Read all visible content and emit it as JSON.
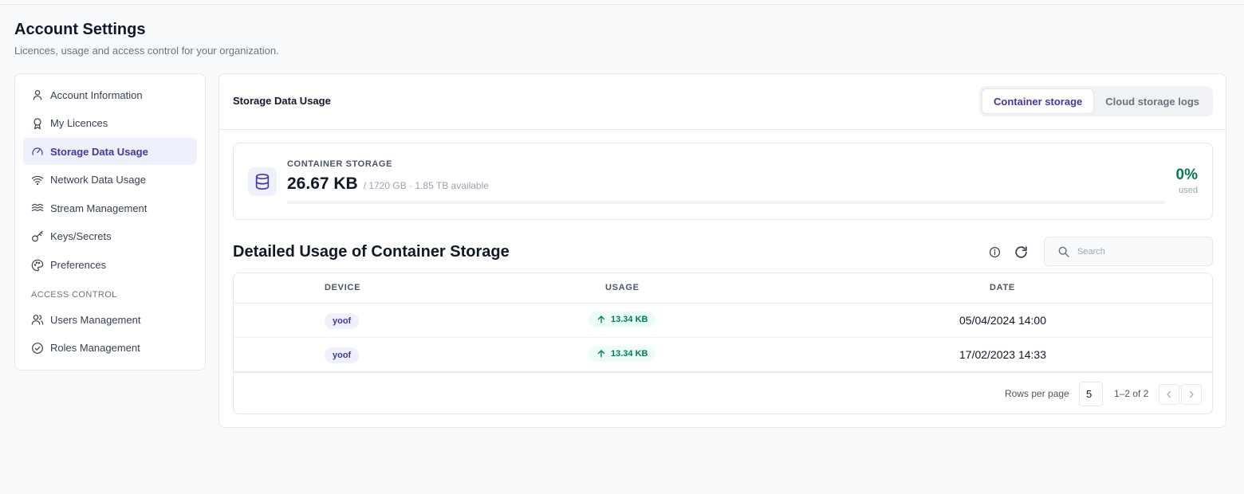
{
  "page": {
    "title": "Account Settings",
    "subtitle": "Licences, usage and access control for your organization."
  },
  "sidebar": {
    "items": [
      {
        "label": "Account Information",
        "icon": "user-icon"
      },
      {
        "label": "My Licences",
        "icon": "award-icon"
      },
      {
        "label": "Storage Data Usage",
        "icon": "gauge-icon",
        "active": true
      },
      {
        "label": "Network Data Usage",
        "icon": "wifi-icon"
      },
      {
        "label": "Stream Management",
        "icon": "waves-icon"
      },
      {
        "label": "Keys/Secrets",
        "icon": "key-icon"
      },
      {
        "label": "Preferences",
        "icon": "palette-icon"
      }
    ],
    "section_label": "Access Control",
    "access_items": [
      {
        "label": "Users Management",
        "icon": "users-icon"
      },
      {
        "label": "Roles Management",
        "icon": "check-circle-icon"
      }
    ]
  },
  "main": {
    "title": "Storage Data Usage",
    "tabs": [
      {
        "label": "Container storage",
        "active": true
      },
      {
        "label": "Cloud storage logs",
        "active": false
      }
    ]
  },
  "storage": {
    "label": "Container storage",
    "used": "26.67 KB",
    "total": "/ 1720 GB · 1.85 TB available",
    "percent": "0%",
    "percent_value": 0,
    "percent_caption": "used",
    "icon": "database-icon"
  },
  "detail": {
    "title": "Detailed Usage of Container Storage",
    "search_placeholder": "Search",
    "columns": {
      "device": "Device",
      "usage": "Usage",
      "date": "Date"
    },
    "rows": [
      {
        "device": "yoof",
        "usage": "13.34 KB",
        "date": "05/04/2024 14:00"
      },
      {
        "device": "yoof",
        "usage": "13.34 KB",
        "date": "17/02/2023 14:33"
      }
    ],
    "rows_per_page_label": "Rows per page",
    "rows_per_page": "5",
    "range": "1–2 of 2"
  },
  "colors": {
    "accent": "#3f3a9e",
    "accent_bg": "#eef0fb",
    "success": "#047857",
    "success_bg": "#ecfdf5"
  }
}
